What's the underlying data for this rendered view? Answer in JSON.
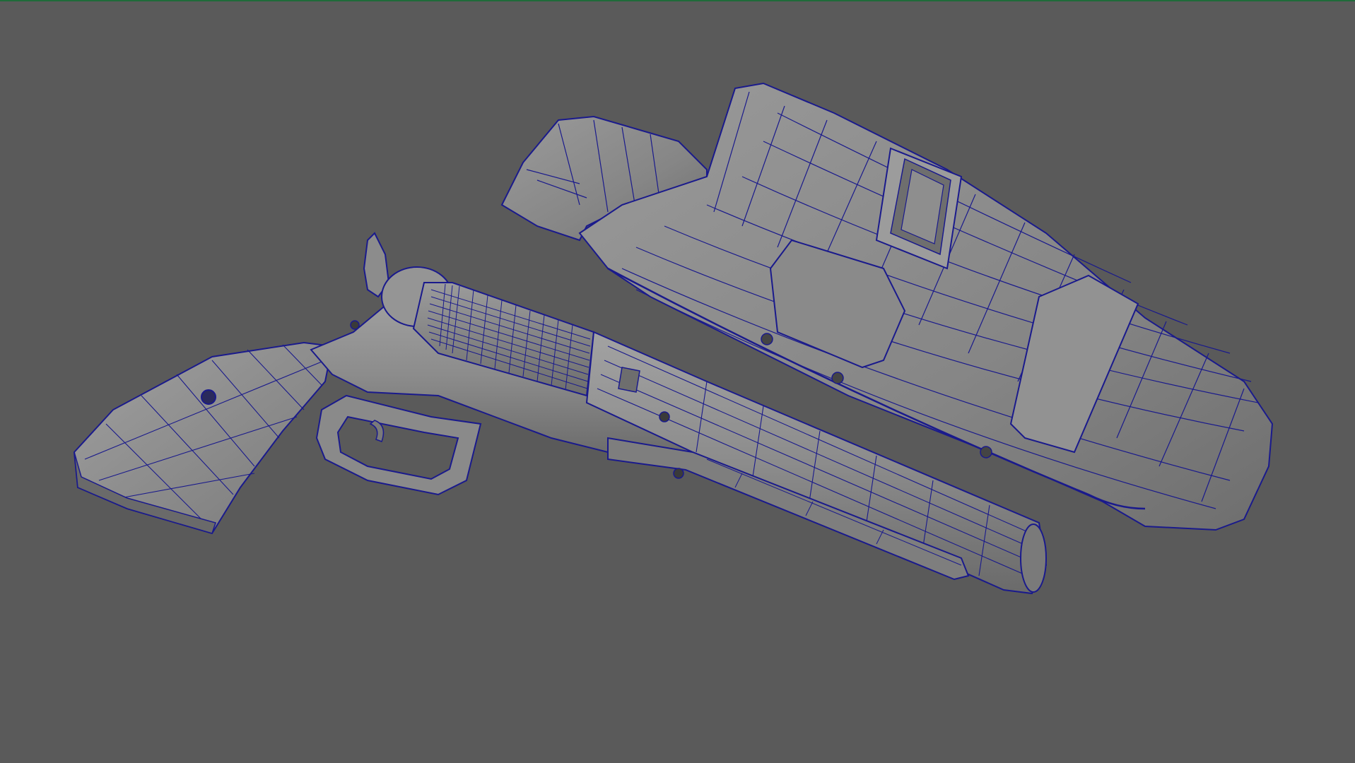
{
  "viewport": {
    "background_color": "#5a5a5a",
    "active_border_color": "#1f6b3a",
    "wireframe_color": "#1a1a8c",
    "shaded_color": "#8c8c8c",
    "highlight_color": "#b4b4b4",
    "shadow_color": "#3c3c3c"
  },
  "objects": [
    {
      "name": "revolver",
      "icon": "wireframe-mesh"
    },
    {
      "name": "holster",
      "icon": "wireframe-mesh"
    }
  ]
}
